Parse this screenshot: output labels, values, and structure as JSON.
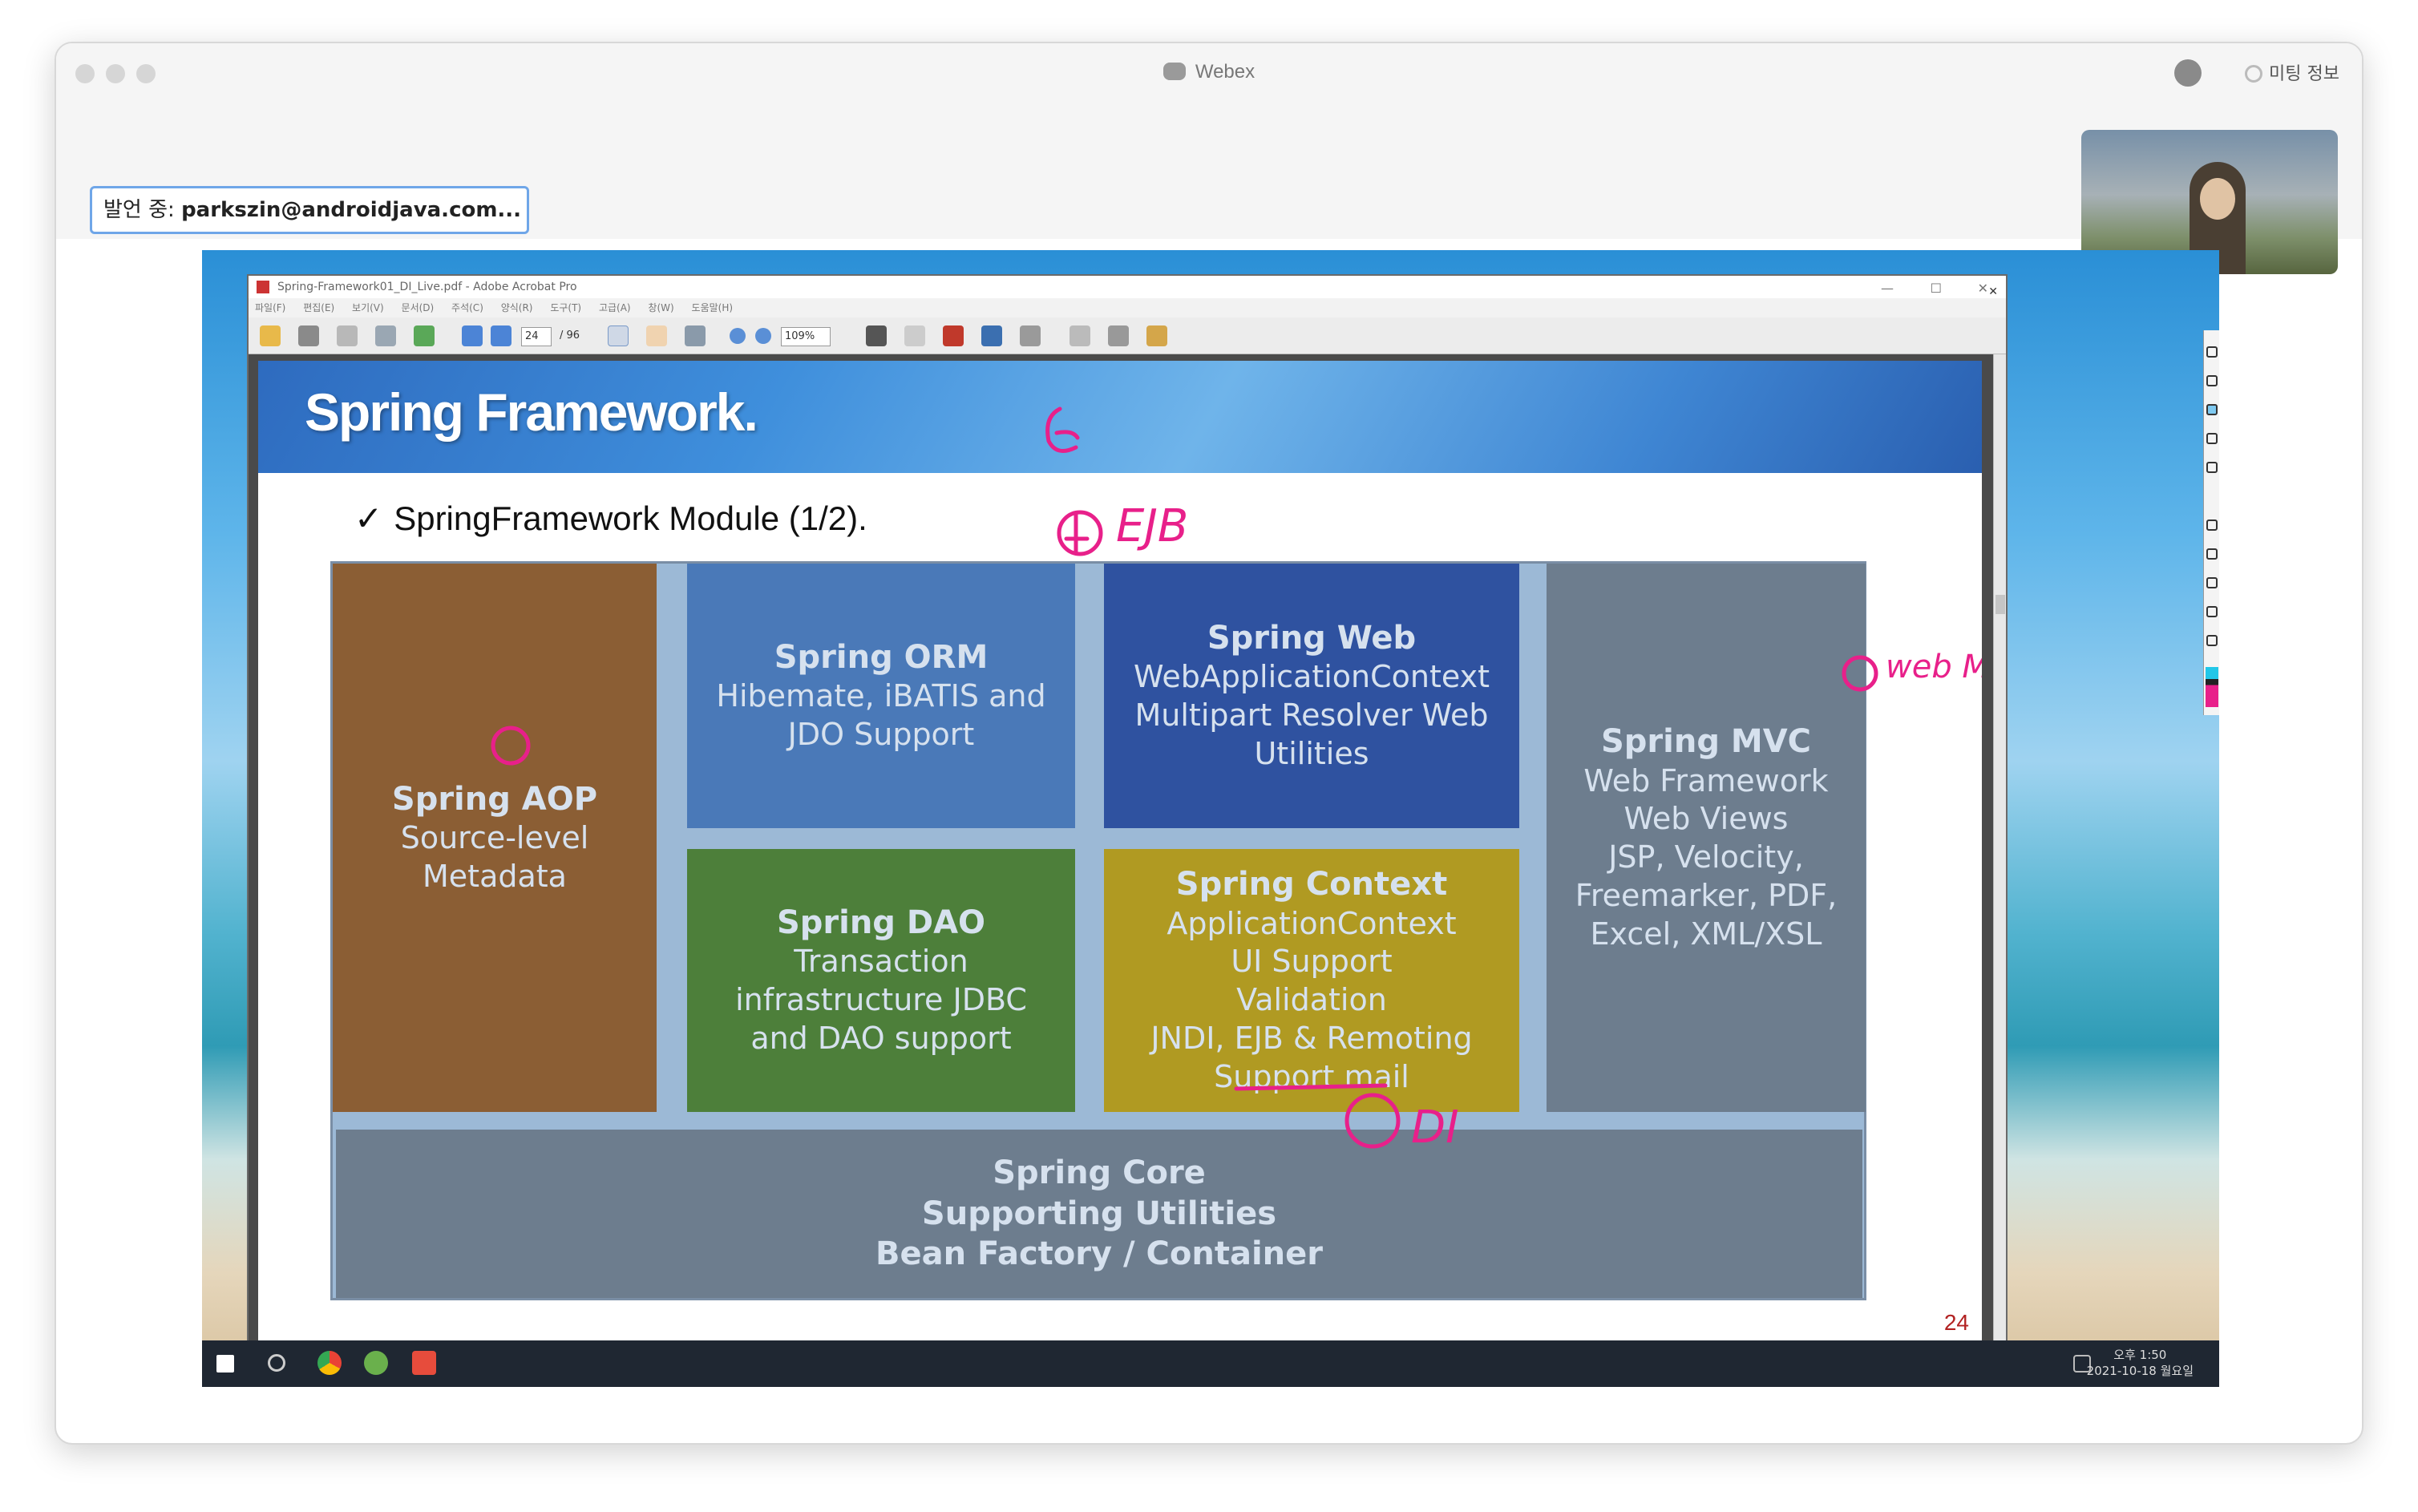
{
  "app": {
    "title": "Webex",
    "meeting_info": "미팅 정보",
    "speaker_label": "발언 중:",
    "speaker_name": "parkszin@androidjava.com..."
  },
  "acrobat": {
    "window_title": "Spring-Framework01_DI_Live.pdf - Adobe Acrobat Pro",
    "menu": [
      "파일(F)",
      "편집(E)",
      "보기(V)",
      "문서(D)",
      "주석(C)",
      "양식(R)",
      "도구(T)",
      "고급(A)",
      "창(W)",
      "도움말(H)"
    ],
    "page_current": "24",
    "page_total": "/ 96",
    "zoom": "109%"
  },
  "slide": {
    "title": "Spring Framework.",
    "subtitle": "SpringFramework Module (1/2).",
    "page_number": "24",
    "modules": {
      "aop": {
        "title": "Spring AOP",
        "lines": [
          "Source-level",
          "Metadata"
        ]
      },
      "orm": {
        "title": "Spring ORM",
        "lines": [
          "Hibemate, iBATIS and",
          "JDO Support"
        ]
      },
      "web": {
        "title": "Spring Web",
        "lines": [
          "WebApplicationContext",
          "Multipart Resolver Web",
          "Utilities"
        ]
      },
      "mvc": {
        "title": "Spring MVC",
        "lines": [
          "Web Framework",
          "Web Views",
          "JSP, Velocity,",
          "Freemarker, PDF,",
          "Excel, XML/XSL"
        ]
      },
      "dao": {
        "title": "Spring DAO",
        "lines": [
          "Transaction",
          "infrastructure JDBC",
          "and DAO support"
        ]
      },
      "context": {
        "title": "Spring Context",
        "lines": [
          "ApplicationContext",
          "UI Support",
          "Validation",
          "JNDI, EJB & Remoting",
          "Support mail"
        ]
      },
      "core": {
        "title": "Spring Core",
        "lines": [
          "Supporting Utilities",
          "Bean Factory / Container"
        ]
      }
    },
    "colors": {
      "aop": "#8b5e34",
      "orm": "#4a79b8",
      "web": "#2f52a0",
      "mvc": "#6d7d8e",
      "dao": "#4d7f3a",
      "context": "#b09a22",
      "core": "#6d7d8e",
      "ink": "#e8208a"
    }
  },
  "annotations": [
    "EJB",
    "DI",
    "web MVC"
  ],
  "taskbar": {
    "time": "오후 1:50",
    "date": "2021-10-18 월요일"
  }
}
